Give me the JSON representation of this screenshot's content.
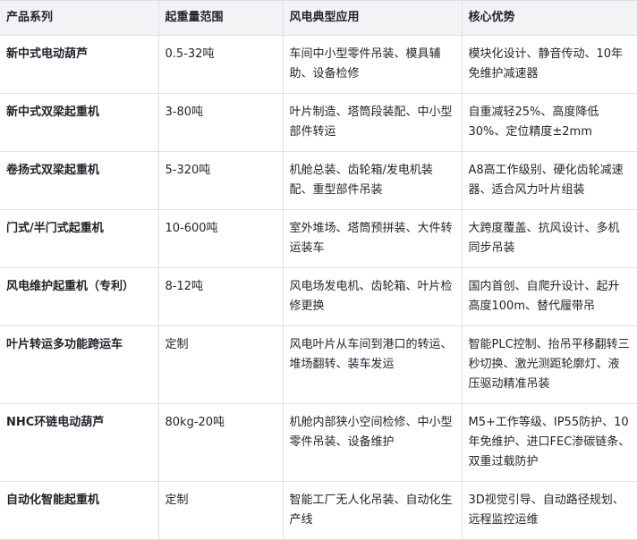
{
  "headers": [
    "产品系列",
    "起重量范围",
    "风电典型应用",
    "核心优势"
  ],
  "rows": [
    {
      "name": "新中式电动葫芦",
      "range": "0.5-32吨",
      "app": "车间中小型零件吊装、模具辅助、设备检修",
      "adv": "模块化设计、静音传动、10年免维护减速器"
    },
    {
      "name": "新中式双梁起重机",
      "range": "3-80吨",
      "app": "叶片制造、塔筒段装配、中小型部件转运",
      "adv": "自重减轻25%、高度降低30%、定位精度±2mm"
    },
    {
      "name": "卷扬式双梁起重机",
      "range": "5-320吨",
      "app": "机舱总装、齿轮箱/发电机装配、重型部件吊装",
      "adv": "A8高工作级别、硬化齿轮减速器、适合风力叶片组装"
    },
    {
      "name": "门式/半门式起重机",
      "range": "10-600吨",
      "app": "室外堆场、塔筒预拼装、大件转运装车",
      "adv": "大跨度覆盖、抗风设计、多机同步吊装"
    },
    {
      "name": "风电维护起重机（专利）",
      "range": "8-12吨",
      "app": "风电场发电机、齿轮箱、叶片检修更换",
      "adv": "国内首创、自爬升设计、起升高度100m、替代履带吊"
    },
    {
      "name": "叶片转运多功能跨运车",
      "range": "定制",
      "app": "风电叶片从车间到港口的转运、堆场翻转、装车发运",
      "adv": "智能PLC控制、抬吊平移翻转三秒切换、激光测距轮廓灯、液压驱动精准吊装"
    },
    {
      "name": "NHC环链电动葫芦",
      "range": "80kg-20吨",
      "app": "机舱内部狭小空间检修、中小型零件吊装、设备维护",
      "adv": "M5+工作等级、IP55防护、10年免维护、进口FEC渗碳链条、双重过载防护"
    },
    {
      "name": "自动化智能起重机",
      "range": "定制",
      "app": "智能工厂无人化吊装、自动化生产线",
      "adv": "3D视觉引导、自动路径规划、远程监控运维"
    }
  ]
}
